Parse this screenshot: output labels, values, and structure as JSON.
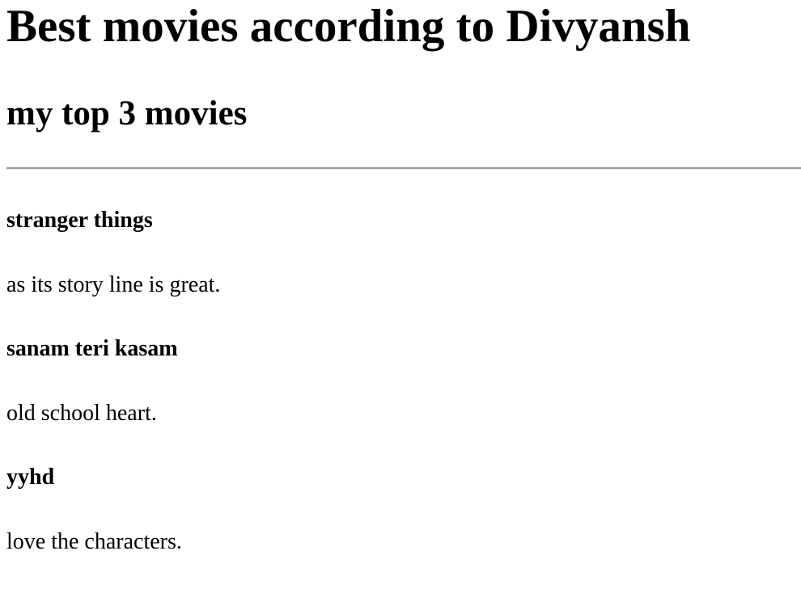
{
  "page": {
    "heading": "Best movies according to Divyansh",
    "subheading": "my top 3 movies"
  },
  "movies": [
    {
      "title": "stranger things",
      "reason": "as its story line is great."
    },
    {
      "title": "sanam teri kasam",
      "reason": "old school heart."
    },
    {
      "title": "yyhd",
      "reason": "love the characters."
    }
  ]
}
